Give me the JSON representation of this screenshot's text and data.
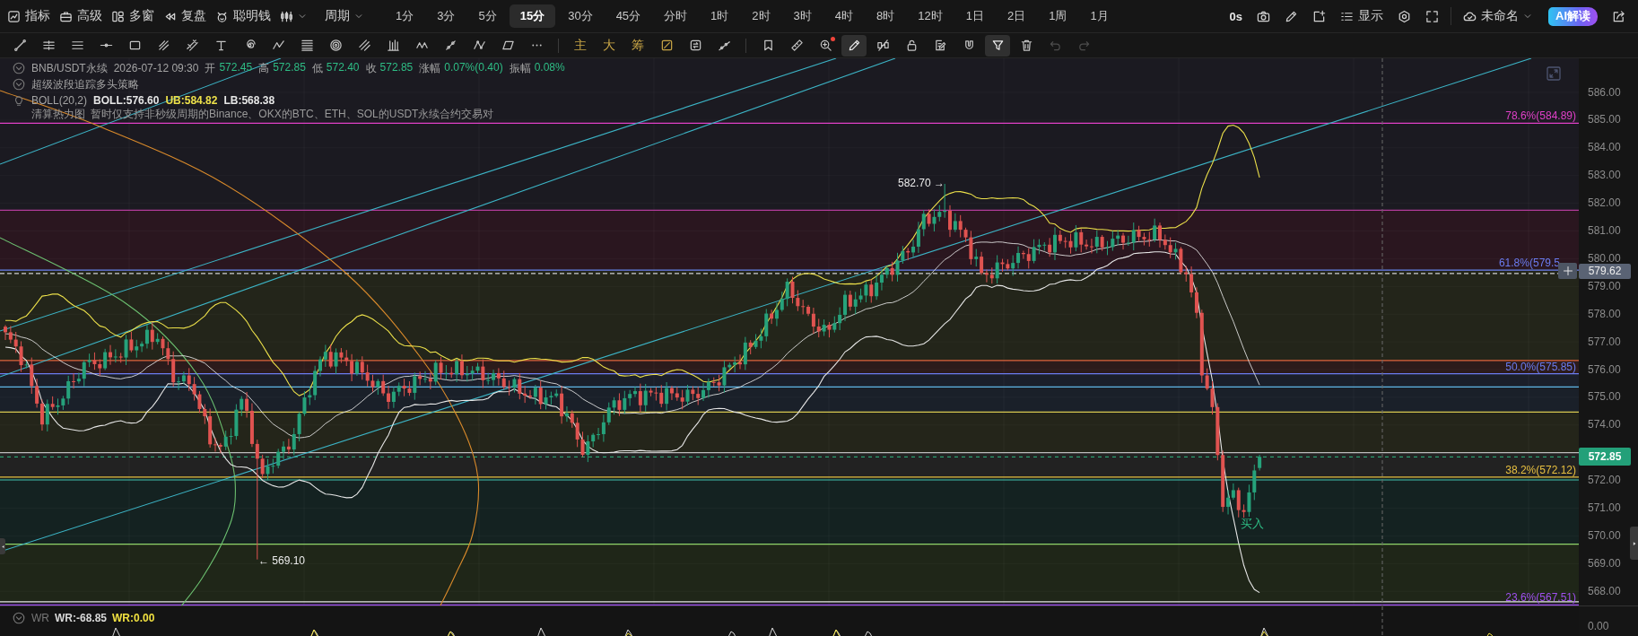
{
  "top_bar": {
    "menu_items": [
      {
        "kind": "indicators",
        "label": "指标"
      },
      {
        "kind": "advanced",
        "label": "高级"
      },
      {
        "kind": "multi-window",
        "label": "多窗"
      },
      {
        "kind": "replay",
        "label": "复盘"
      },
      {
        "kind": "smart-money",
        "label": "聪明钱"
      },
      {
        "kind": "chart-style"
      }
    ],
    "period_menu": "周期",
    "periods": [
      {
        "label": "1分",
        "selected": false
      },
      {
        "label": "3分",
        "selected": false
      },
      {
        "label": "5分",
        "selected": false
      },
      {
        "label": "15分",
        "selected": true
      },
      {
        "label": "30分",
        "selected": false
      },
      {
        "label": "45分",
        "selected": false
      },
      {
        "label": "分时",
        "selected": false
      },
      {
        "label": "1时",
        "selected": false
      },
      {
        "label": "2时",
        "selected": false
      },
      {
        "label": "3时",
        "selected": false
      },
      {
        "label": "4时",
        "selected": false
      },
      {
        "label": "8时",
        "selected": false
      },
      {
        "label": "12时",
        "selected": false
      },
      {
        "label": "1日",
        "selected": false
      },
      {
        "label": "2日",
        "selected": false
      },
      {
        "label": "1周",
        "selected": false
      },
      {
        "label": "1月",
        "selected": false
      }
    ],
    "countdown": "0s",
    "tools": [
      {
        "kind": "camera"
      },
      {
        "kind": "pencil"
      },
      {
        "kind": "add-note"
      },
      {
        "kind": "display",
        "label": "显示"
      },
      {
        "kind": "settings"
      },
      {
        "kind": "fullscreen"
      }
    ],
    "layout_name": "未命名",
    "ai_button": "AI解读"
  },
  "drawing_toolbar": {
    "draw_tools": [
      {
        "kind": "diagonal-line",
        "selected": false
      },
      {
        "kind": "handle-lines",
        "selected": false
      },
      {
        "kind": "three-lines",
        "selected": false
      },
      {
        "kind": "horizontal-line",
        "selected": false
      },
      {
        "kind": "rectangle",
        "selected": false
      },
      {
        "kind": "curved-lines",
        "selected": false
      },
      {
        "kind": "crossed-lines",
        "selected": false
      },
      {
        "kind": "text-tool",
        "selected": false
      },
      {
        "kind": "spiral",
        "selected": false
      },
      {
        "kind": "zigzag",
        "selected": false
      },
      {
        "kind": "stacked-lines",
        "selected": false
      },
      {
        "kind": "concentric-circles",
        "selected": false
      },
      {
        "kind": "slash-lines",
        "selected": false
      },
      {
        "kind": "vertical-bars",
        "selected": false
      },
      {
        "kind": "wave-line",
        "selected": false
      },
      {
        "kind": "endpoint-line",
        "selected": false
      },
      {
        "kind": "zigzag-points",
        "selected": false
      },
      {
        "kind": "parallelogram",
        "selected": false
      },
      {
        "kind": "more",
        "selected": false
      }
    ],
    "chart_tools": [
      {
        "kind": "text",
        "label": "主",
        "selected": false
      },
      {
        "kind": "text",
        "label": "大",
        "selected": false
      },
      {
        "kind": "text",
        "label": "筹",
        "selected": false
      },
      {
        "kind": "slashed-square",
        "selected": false
      },
      {
        "kind": "square-arrows",
        "selected": false
      },
      {
        "kind": "line-points",
        "selected": false
      }
    ],
    "edit_tools": [
      {
        "kind": "bookmark",
        "selected": false,
        "disabled": false,
        "dot": false
      },
      {
        "kind": "ruler",
        "selected": false,
        "disabled": false,
        "dot": false
      },
      {
        "kind": "zoom-in",
        "selected": false,
        "disabled": false,
        "dot": true
      },
      {
        "kind": "pencil",
        "selected": true,
        "disabled": false,
        "dot": false
      },
      {
        "kind": "crossed-links",
        "selected": false,
        "disabled": false,
        "dot": false
      },
      {
        "kind": "padlock",
        "selected": false,
        "disabled": false,
        "dot": false
      },
      {
        "kind": "edit-note",
        "selected": false,
        "disabled": false,
        "dot": false
      },
      {
        "kind": "magnet",
        "selected": false,
        "disabled": false,
        "dot": false
      },
      {
        "kind": "filter",
        "selected": true,
        "disabled": false,
        "dot": false
      },
      {
        "kind": "trash",
        "selected": false,
        "disabled": false,
        "dot": false
      },
      {
        "kind": "undo",
        "selected": false,
        "disabled": true,
        "dot": false
      },
      {
        "kind": "redo",
        "selected": false,
        "disabled": true,
        "dot": false
      }
    ]
  },
  "chart": {
    "legend": {
      "symbol": "BNB/USDT永续",
      "time": "2026-07-12 09:30",
      "fields": [
        {
          "label": "开",
          "value": "572.45"
        },
        {
          "label": "高",
          "value": "572.85"
        },
        {
          "label": "低",
          "value": "572.40"
        },
        {
          "label": "收",
          "value": "572.85"
        },
        {
          "label": "涨幅",
          "value": "0.07%(0.40)"
        },
        {
          "label": "振幅",
          "value": "0.08%"
        }
      ]
    },
    "strategy": "超级波段追踪多头策略",
    "boll": {
      "name": "BOLL(20,2)",
      "values": [
        {
          "text": "BOLL:576.60",
          "color": "#e6e6e6"
        },
        {
          "text": "UB:584.82",
          "color": "#ece04a"
        },
        {
          "text": "LB:568.38",
          "color": "#e6e6e6"
        }
      ]
    },
    "heatmap": {
      "title": "清算热力图",
      "note": "暂时仅支持非秒级周期的Binance、OKX的BTC、ETH、SOL的USDT永续合约交易对"
    },
    "fib_levels": [
      {
        "label": "78.6%(584.89)",
        "color": "#e040c8"
      },
      {
        "label": "61.8%(579.5",
        "color": "#6b7cf0"
      },
      {
        "label": "50.0%(575.85)",
        "color": "#6b7cf0"
      },
      {
        "label": "38.2%(572.12)",
        "color": "#e8c040"
      },
      {
        "label": "23.6%(567.51)",
        "color": "#a050f0"
      }
    ],
    "markers": [
      {
        "kind": "high",
        "text": "582.70 →"
      },
      {
        "kind": "low",
        "text": "← 569.10"
      },
      {
        "kind": "buy",
        "text": "买入"
      }
    ],
    "price_line": "579.62",
    "last_price": "572.85",
    "price_axis": [
      "586.00",
      "585.00",
      "584.00",
      "583.00",
      "582.00",
      "581.00",
      "580.00",
      "579.00",
      "578.00",
      "577.00",
      "576.00",
      "575.00",
      "574.00",
      "572.00",
      "571.00",
      "570.00",
      "569.00",
      "568.00"
    ]
  },
  "wr_pane": {
    "name": "WR",
    "values": [
      {
        "text": "WR:-68.85",
        "color": "#d8d8d8"
      },
      {
        "text": "WR:0.00",
        "color": "#f0e040"
      }
    ],
    "axis": "0.00"
  }
}
